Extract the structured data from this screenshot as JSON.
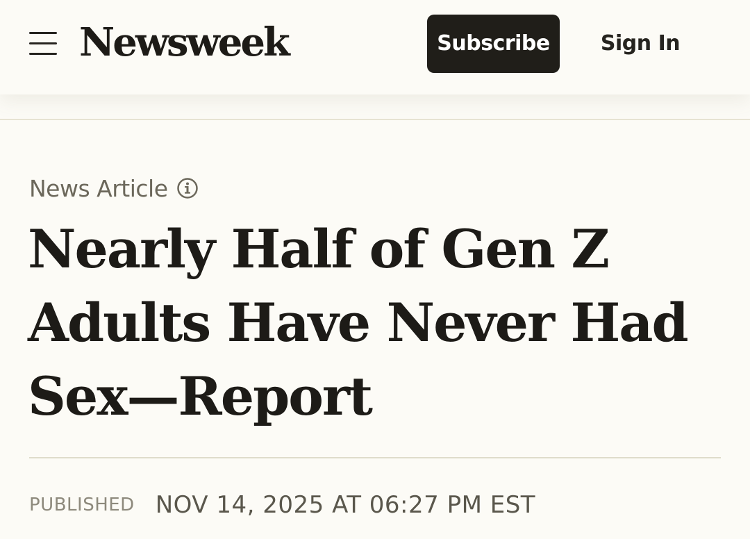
{
  "header": {
    "menu_icon": "hamburger-menu-icon",
    "logo_text": "Newsweek",
    "subscribe_label": "Subscribe",
    "signin_label": "Sign In",
    "colors": {
      "background": "#fcfbf6",
      "button_dark": "#201e19",
      "button_text": "#ffffff"
    }
  },
  "article": {
    "type_label": "News Article",
    "type_info_icon": "info-circle-icon",
    "headline": "Nearly Half of Gen Z Adults Have Never Had Sex—Report",
    "published_label": "PUBLISHED",
    "published_date": "NOV 14, 2025 AT 06:27 PM EST"
  }
}
